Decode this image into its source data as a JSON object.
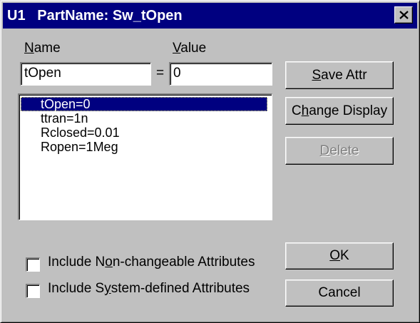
{
  "window": {
    "title": "U1   PartName: Sw_tOpen",
    "close_icon": "close-icon"
  },
  "form": {
    "name_label": "Name",
    "value_label": "Value",
    "name_value": "tOpen",
    "equals": "=",
    "value_value": "0"
  },
  "attributes": {
    "items": [
      "tOpen=0",
      "ttran=1n",
      "Rclosed=0.01",
      "Ropen=1Meg"
    ],
    "selected": "tOpen=0"
  },
  "buttons": {
    "save_attr": "Save Attr",
    "change_display": "Change Display",
    "delete": "Delete",
    "ok": "OK",
    "cancel": "Cancel"
  },
  "options": {
    "include_non_changeable": "Include Non-changeable Attributes",
    "include_non_changeable_checked": false,
    "include_system_defined": "Include System-defined Attributes",
    "include_system_defined_checked": false
  }
}
